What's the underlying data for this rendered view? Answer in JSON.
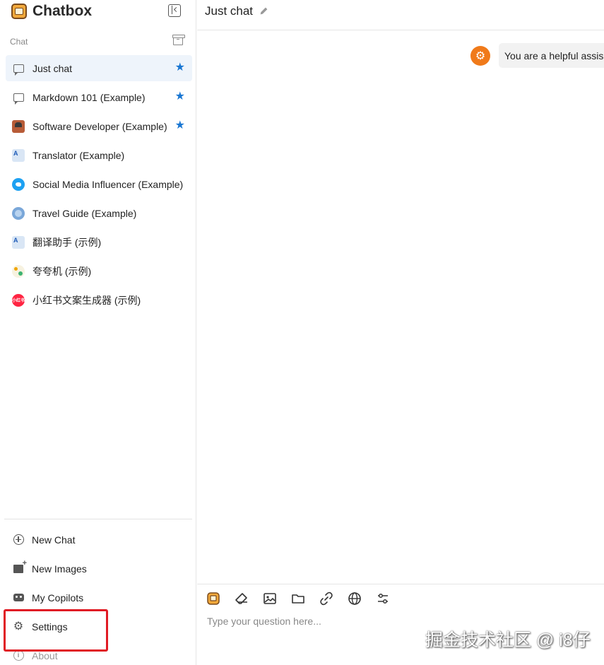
{
  "app": {
    "name": "Chatbox"
  },
  "sidebar": {
    "section_label": "Chat",
    "chats": [
      {
        "label": "Just chat",
        "icon": "chat-bubble-icon",
        "starred": true,
        "active": true
      },
      {
        "label": "Markdown 101 (Example)",
        "icon": "chat-bubble-icon",
        "starred": true,
        "active": false
      },
      {
        "label": "Software Developer (Example)",
        "icon": "developer-avatar",
        "starred": true,
        "active": false
      },
      {
        "label": "Translator (Example)",
        "icon": "translator-avatar",
        "starred": false,
        "active": false
      },
      {
        "label": "Social Media Influencer (Example)",
        "icon": "twitter-avatar",
        "starred": false,
        "active": false
      },
      {
        "label": "Travel Guide (Example)",
        "icon": "travel-avatar",
        "starred": false,
        "active": false
      },
      {
        "label": "翻译助手 (示例)",
        "icon": "translator-avatar",
        "starred": false,
        "active": false
      },
      {
        "label": "夸夸机 (示例)",
        "icon": "kuakua-avatar",
        "starred": false,
        "active": false
      },
      {
        "label": "小红书文案生成器 (示例)",
        "icon": "xiaohongshu-avatar",
        "starred": false,
        "active": false
      }
    ],
    "bottom_items": [
      {
        "label": "New Chat",
        "icon": "plus-circle-icon"
      },
      {
        "label": "New Images",
        "icon": "image-add-icon"
      },
      {
        "label": "My Copilots",
        "icon": "robot-icon"
      },
      {
        "label": "Settings",
        "icon": "gear-icon"
      },
      {
        "label": "About",
        "icon": "info-icon"
      }
    ],
    "xiaohongshu_avatar_text": "小红书"
  },
  "main": {
    "title": "Just chat",
    "messages": [
      {
        "role": "system",
        "text": "You are a helpful assis",
        "avatar_color": "#f07a1a"
      }
    ],
    "composer": {
      "placeholder": "Type your question here...",
      "tools": [
        "chatbox-logo-icon",
        "eraser-icon",
        "image-icon",
        "folder-icon",
        "link-icon",
        "globe-icon",
        "sliders-icon"
      ]
    }
  },
  "watermark": "掘金技术社区 @ i8仔",
  "colors": {
    "accent": "#1976d2",
    "highlight": "#e01b24",
    "system_avatar": "#f07a1a",
    "active_item_bg": "#eef4fb"
  }
}
